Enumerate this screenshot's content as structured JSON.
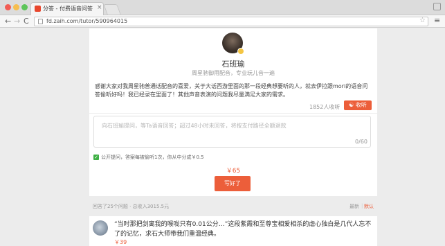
{
  "browser": {
    "tab_title": "分答 - 付费语音问答 - 石班瑜",
    "tab_close": "×",
    "url": "fd.zaih.com/tutor/590964015",
    "nav": {
      "back": "←",
      "forward": "→",
      "reload": "C"
    },
    "icons": {
      "star": "☆",
      "menu": "≡"
    }
  },
  "tutor": {
    "name": "石班瑜",
    "tagline": "周星驰御用配音，专业玩儿音一遍",
    "intro": "感谢大家对我周星驰普通话配音的喜爱，关于大话西游里面的那一段经典想要听的人，就去伊拉跟mori的语音问答偷听好吗！我已经录在里面了！其他声音表演的问题我尽量满足大家的需求。",
    "listeners": "1852人收听",
    "listen_button": "收听"
  },
  "ask": {
    "placeholder": "向石班瑜提问，等Ta语音回答；超过48小时未回答，将按支付路径全额退款",
    "char_count": "0/60",
    "public_label": "公开提问，答案每被偷听1次，你从中分成￥0.5",
    "price": "￥65",
    "submit_button": "写好了"
  },
  "stats": {
    "summary": "回答了25个问题 · 总收入3015.5元",
    "sort_latest": "最新",
    "sort_separator": "|",
    "sort_default": "默认"
  },
  "answers": [
    {
      "text": "“当时那把剑离我的喉咙只有0.01公分…”这段紫霞和至尊宝相爱相杀的虐心独白是几代人忘不了的记忆，求石大师带我们重温经典。",
      "price": "￥39"
    }
  ],
  "colors": {
    "accent": "#ec5e3a",
    "check_green": "#3fb045"
  }
}
